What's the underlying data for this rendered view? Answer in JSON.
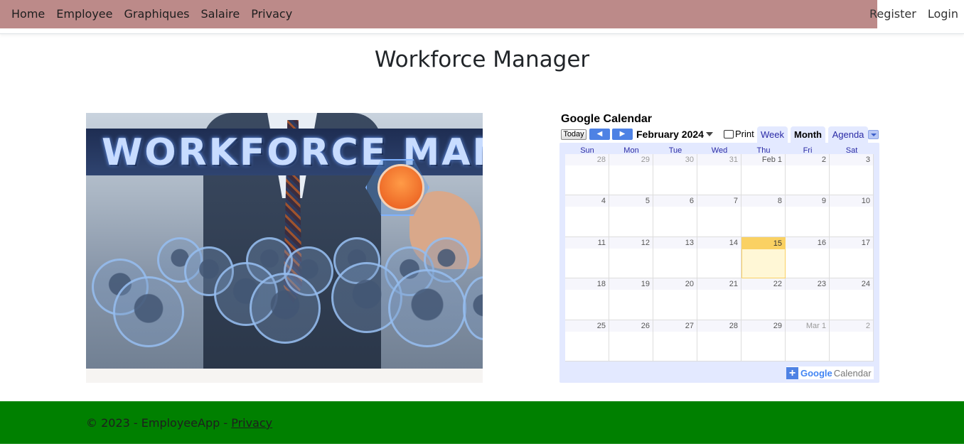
{
  "nav": {
    "left_items": [
      "Home",
      "Employee",
      "Graphiques",
      "Salaire",
      "Privacy"
    ],
    "right_items": [
      "Register",
      "Login"
    ],
    "bar_color": "#bc8a89"
  },
  "page": {
    "title": "Workforce Manager"
  },
  "hero": {
    "banner_text": "WORKFORCE MANAGE"
  },
  "calendar": {
    "title": "Google Calendar",
    "today_label": "Today",
    "month_label": "February 2024",
    "print_label": "Print",
    "tabs": [
      "Week",
      "Month",
      "Agenda"
    ],
    "active_tab": "Month",
    "weekdays": [
      "Sun",
      "Mon",
      "Tue",
      "Wed",
      "Thu",
      "Fri",
      "Sat"
    ],
    "weeks": [
      [
        "28",
        "29",
        "30",
        "31",
        "Feb 1",
        "2",
        "3"
      ],
      [
        "4",
        "5",
        "6",
        "7",
        "8",
        "9",
        "10"
      ],
      [
        "11",
        "12",
        "13",
        "14",
        "15",
        "16",
        "17"
      ],
      [
        "18",
        "19",
        "20",
        "21",
        "22",
        "23",
        "24"
      ],
      [
        "25",
        "26",
        "27",
        "28",
        "29",
        "Mar 1",
        "2"
      ]
    ],
    "today": "15",
    "logo_google": "Google",
    "logo_calendar": "Calendar"
  },
  "footer": {
    "copyright": "© 2023 - EmployeeApp - ",
    "privacy_link": "Privacy",
    "color": "#008000"
  }
}
